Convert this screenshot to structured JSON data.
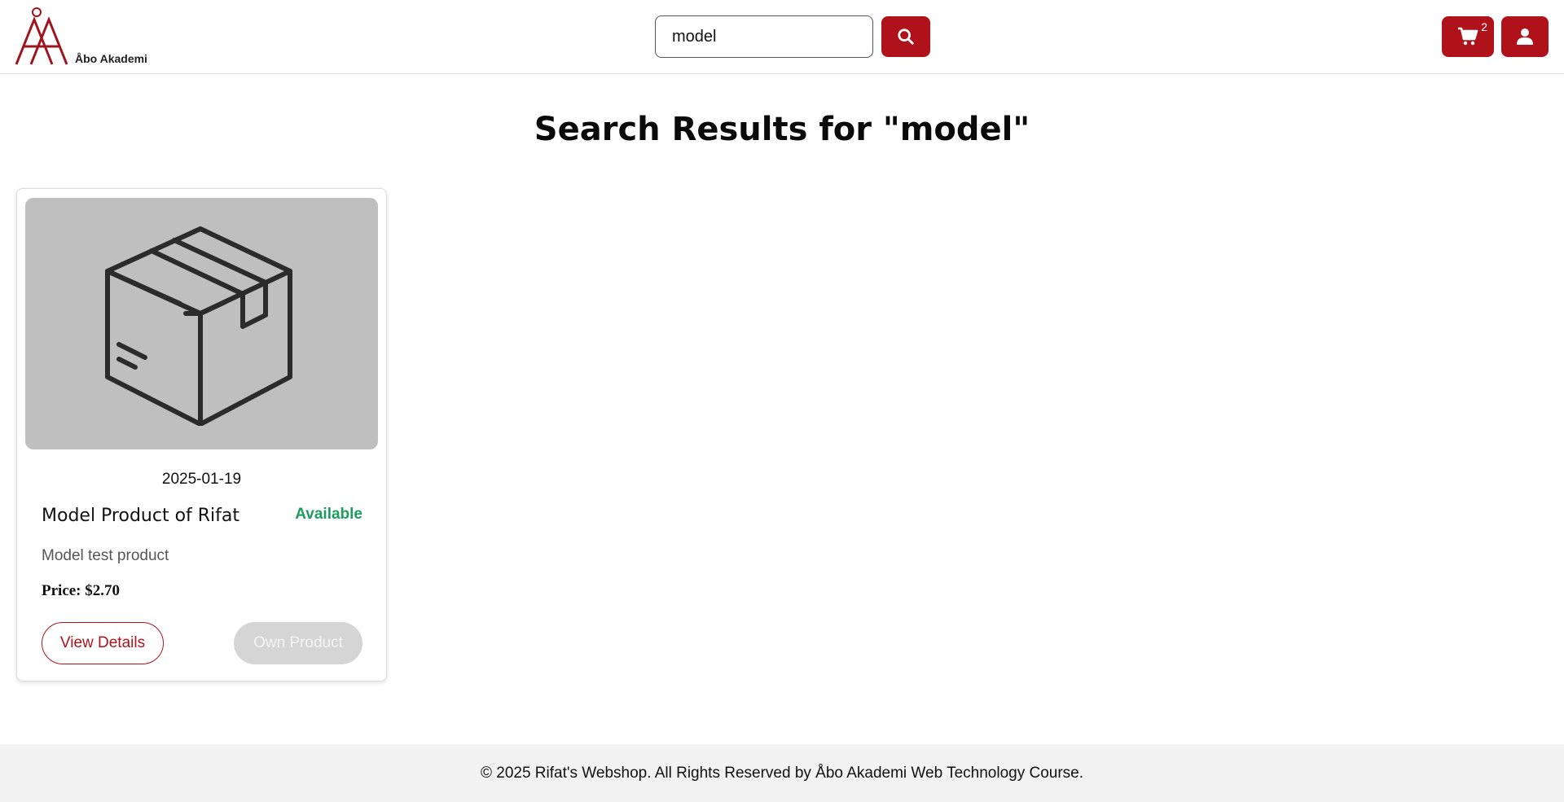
{
  "header": {
    "logo_text": "Åbo Akademi",
    "logo_alt": "ÅA",
    "search": {
      "value": "model",
      "placeholder": ""
    },
    "cart_count": "2",
    "colors": {
      "accent": "#b0121b"
    }
  },
  "main": {
    "title": "Search Results for \"model\"",
    "products": [
      {
        "image_icon": "box-icon",
        "date": "2025-01-19",
        "name": "Model Product of Rifat",
        "status": "Available",
        "description": "Model test product",
        "price": "Price: $2.70",
        "view_label": "View Details",
        "own_label": "Own Product"
      }
    ]
  },
  "footer": {
    "text": "© 2025 Rifat's Webshop. All Rights Reserved by Åbo Akademi Web Technology Course."
  }
}
